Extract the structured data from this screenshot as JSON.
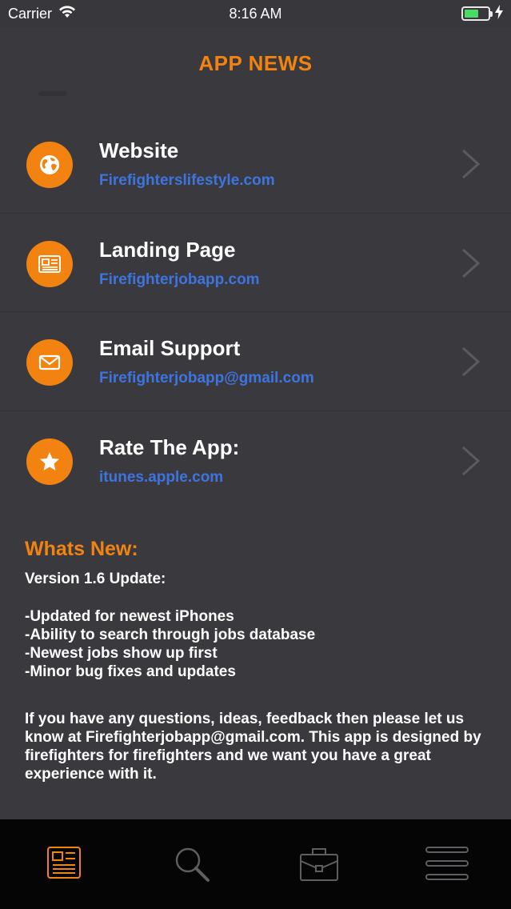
{
  "status": {
    "carrier": "Carrier",
    "time": "8:16 AM"
  },
  "header": {
    "title": "APP NEWS"
  },
  "links": [
    {
      "title": "Website",
      "url": "Firefighterslifestyle.com",
      "icon": "globe-icon"
    },
    {
      "title": "Landing Page",
      "url": "Firefighterjobapp.com",
      "icon": "newspaper-icon"
    },
    {
      "title": "Email Support",
      "url": "Firefighterjobapp@gmail.com",
      "icon": "envelope-icon"
    },
    {
      "title": "Rate The App:",
      "url": "itunes.apple.com",
      "icon": "star-icon"
    }
  ],
  "whats_new": {
    "title": "Whats New:",
    "version": "Version 1.6 Update:",
    "items": [
      "-Updated for newest iPhones",
      "-Ability to search through jobs database",
      "-Newest jobs show up first",
      "-Minor bug fixes and updates"
    ],
    "paragraph": "If you have any questions, ideas, feedback then please let us know at Firefighterjobapp@gmail.com. This app is designed by firefighters for firefighters and we want you have a great experience with it."
  },
  "tabs": [
    {
      "name": "news",
      "icon": "newspaper-icon",
      "active": true
    },
    {
      "name": "search",
      "icon": "search-icon",
      "active": false
    },
    {
      "name": "jobs",
      "icon": "briefcase-icon",
      "active": false
    },
    {
      "name": "menu",
      "icon": "menu-icon",
      "active": false
    }
  ],
  "colors": {
    "accent": "#f28311",
    "link": "#3d74e0",
    "background": "#3a3a3e",
    "tab_bar": "#050505"
  }
}
